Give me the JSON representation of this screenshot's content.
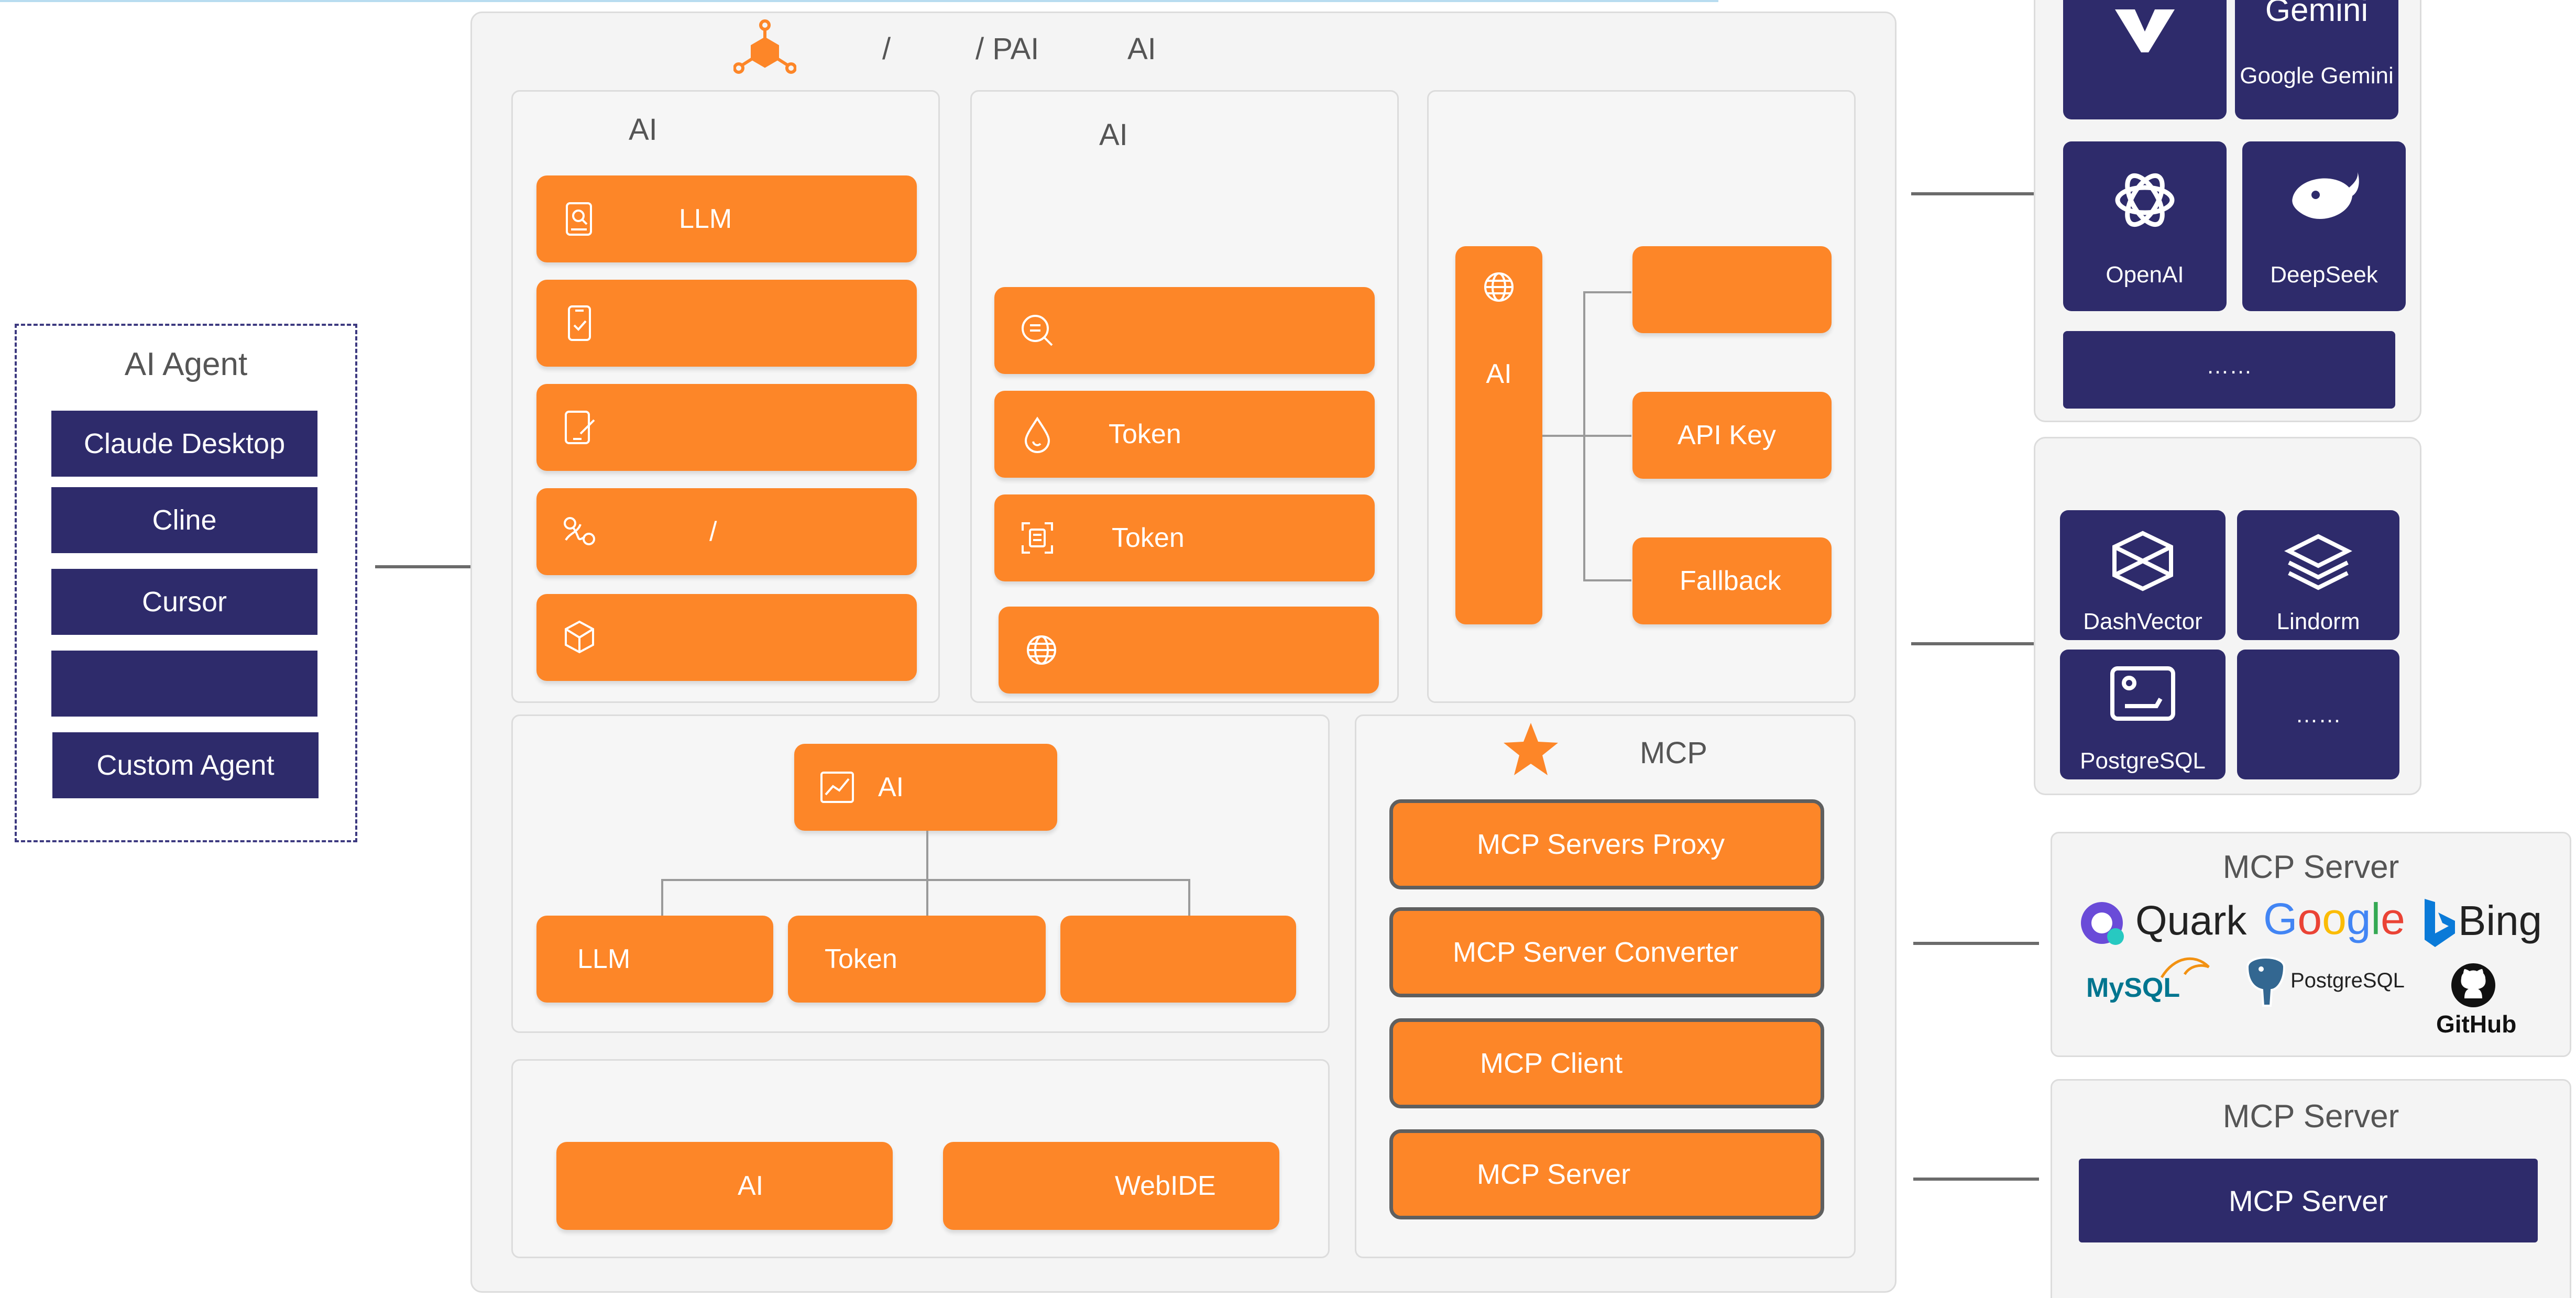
{
  "colors": {
    "orange": "#fd8628",
    "navy": "#2e2b6b",
    "panel_bg": "#f4f4f4",
    "border": "#dcdcdc",
    "gray_text": "#555555"
  },
  "header": {
    "sep1": "/",
    "sep2": "/ PAI",
    "ai": "AI"
  },
  "agent": {
    "title": "AI Agent",
    "items": [
      "Claude Desktop",
      "Cline",
      "Cursor",
      "",
      "Custom Agent"
    ]
  },
  "panel_a": {
    "title": "AI",
    "buttons": [
      "LLM",
      "",
      "",
      "/",
      ""
    ]
  },
  "panel_b": {
    "title": "AI",
    "buttons": [
      "",
      "Token",
      "Token",
      ""
    ]
  },
  "panel_c": {
    "vertical_label": "AI",
    "buttons": [
      "",
      "API Key",
      "Fallback"
    ]
  },
  "panel_d": {
    "root": "AI",
    "children": [
      "LLM",
      "Token",
      ""
    ]
  },
  "panel_e": {
    "buttons": [
      "AI",
      "WebIDE"
    ]
  },
  "mcp": {
    "title": "MCP",
    "buttons": [
      "MCP Servers Proxy",
      "MCP Server Converter",
      "MCP Client",
      "MCP Server"
    ]
  },
  "llm_providers": {
    "gemini_word": "Gemini",
    "gemini_label": "Google Gemini",
    "openai": "OpenAI",
    "deepseek": "DeepSeek",
    "more": "……"
  },
  "vector_db": {
    "dashvector": "DashVector",
    "lindorm": "Lindorm",
    "postgresql": "PostgreSQL",
    "more": "……"
  },
  "mcp_market": {
    "title": "MCP Server",
    "logos": [
      "Quark",
      "Google",
      "Bing",
      "MySQL",
      "PostgreSQL",
      "GitHub"
    ]
  },
  "mcp_custom": {
    "title": "MCP Server",
    "button": "MCP Server"
  }
}
